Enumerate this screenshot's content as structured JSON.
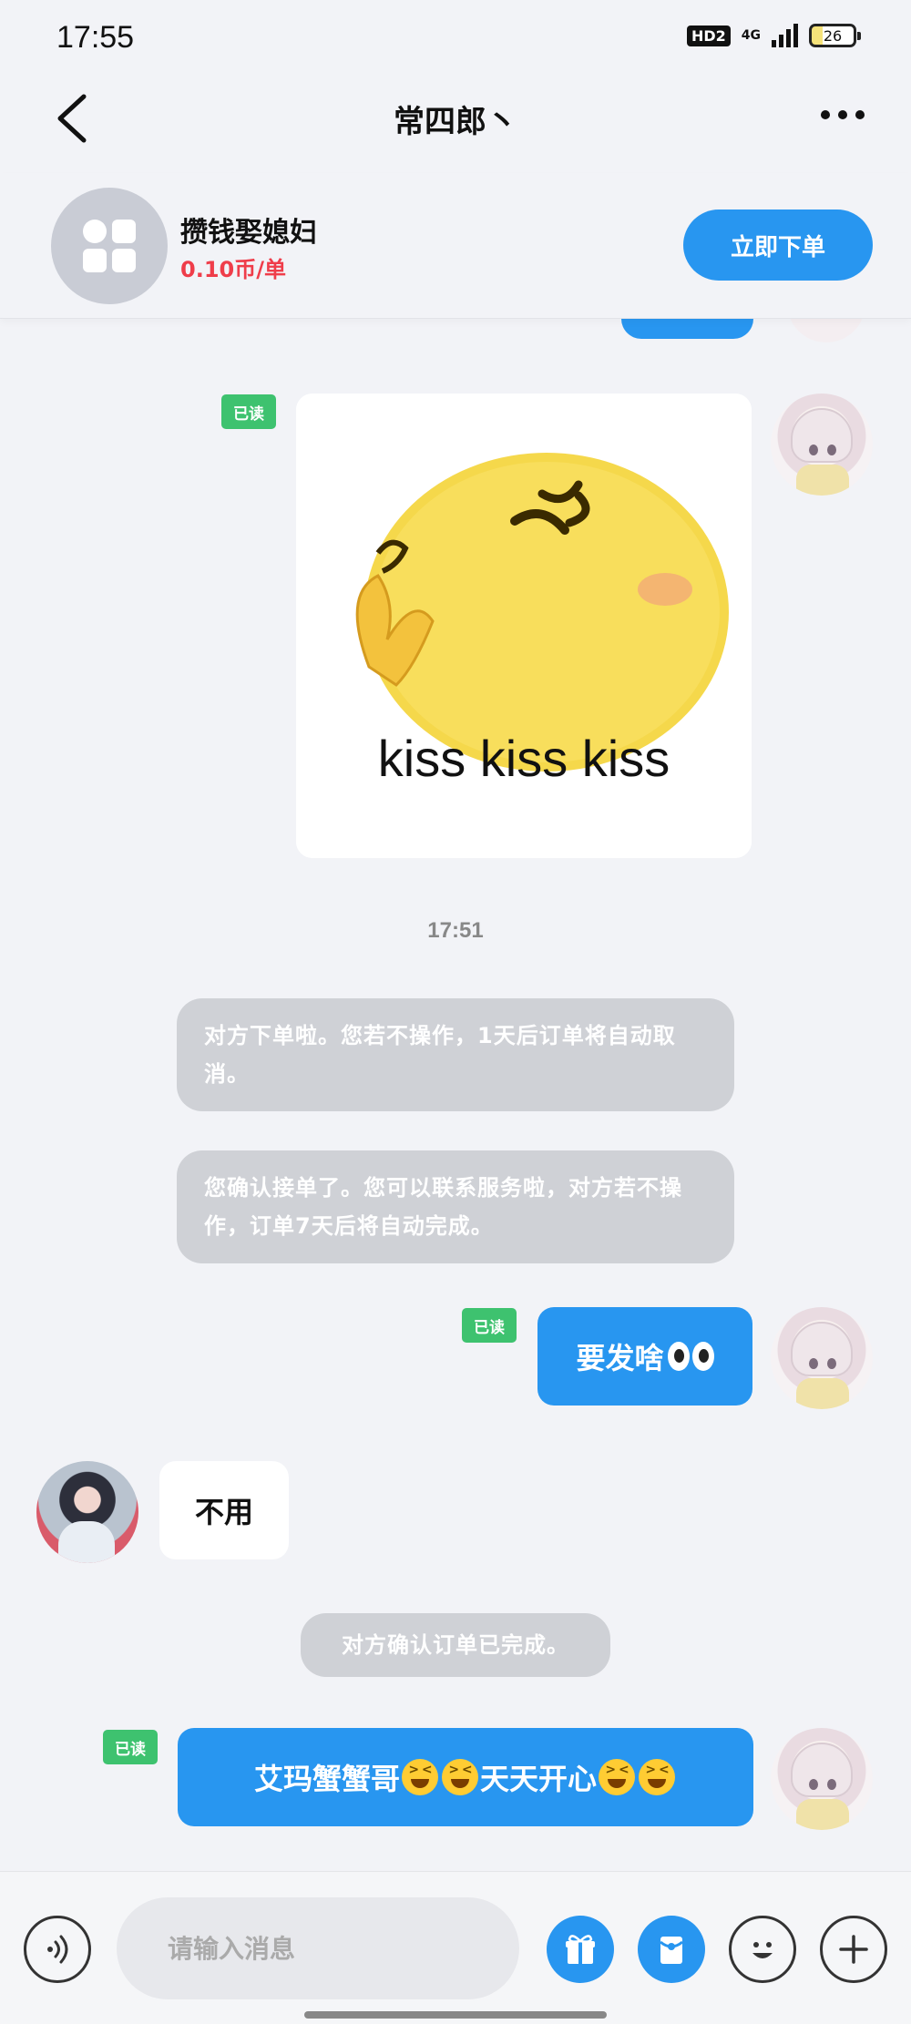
{
  "status_bar": {
    "time": "17:55",
    "hd": "HD2",
    "network": "4G",
    "battery": "26"
  },
  "nav": {
    "title": "常四郎丶"
  },
  "service": {
    "name": "攒钱娶媳妇",
    "price": "0.10币/单",
    "order_button": "立即下单"
  },
  "messages": {
    "read_label": "已读",
    "image_caption": "kiss kiss kiss",
    "timestamp": "17:51",
    "system_1": "对方下单啦。您若不操作，1天后订单将自动取消。",
    "system_2": "您确认接单了。您可以联系服务啦，对方若不操作，订单7天后将自动完成。",
    "me_1": "要发啥",
    "other_1": "不用",
    "system_3": "对方确认订单已完成。",
    "me_2_part1": "艾玛蟹蟹哥",
    "me_2_part2": "天天开心"
  },
  "input": {
    "placeholder": "请输入消息"
  },
  "icons": {
    "back": "chevron-left-icon",
    "more": "more-dots-icon",
    "voice": "voice-icon",
    "gift": "gift-icon",
    "red_packet": "red-packet-icon",
    "emoji": "emoji-icon",
    "plus": "plus-icon"
  },
  "colors": {
    "accent": "#2896f0",
    "price": "#ef3d4a",
    "read_badge": "#3ec26f",
    "system_bubble": "#cfd1d6"
  }
}
